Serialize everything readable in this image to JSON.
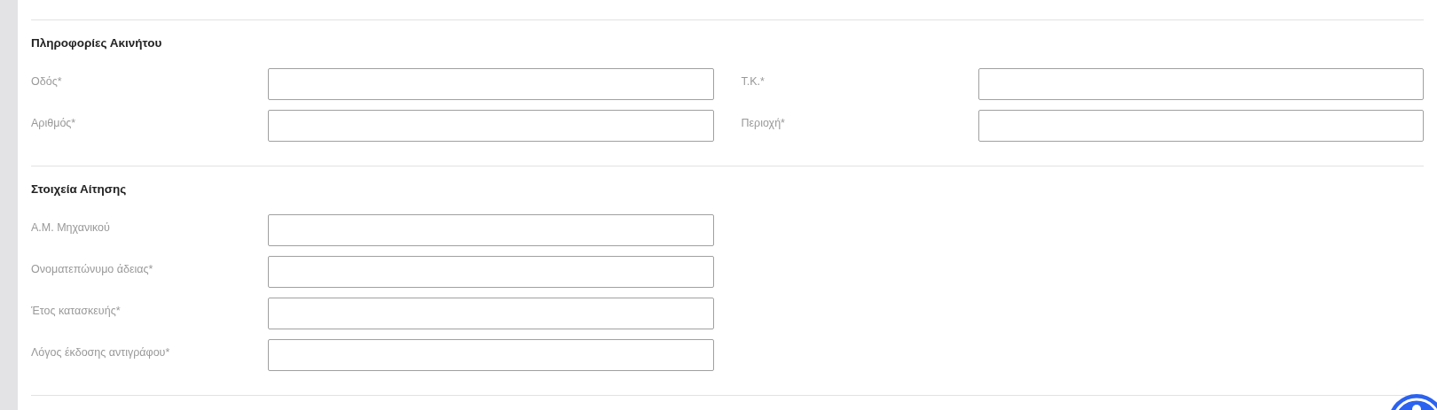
{
  "sections": [
    {
      "title": "Πληροφορίες Ακινήτου",
      "rows": [
        [
          {
            "label": "Οδός*"
          },
          {
            "label": "Τ.Κ.*"
          }
        ],
        [
          {
            "label": "Αριθμός*"
          },
          {
            "label": "Περιοχή*"
          }
        ]
      ]
    },
    {
      "title": "Στοιχεία Αίτησης",
      "rows": [
        [
          {
            "label": "Α.Μ. Μηχανικού"
          }
        ],
        [
          {
            "label": "Ονοματεπώνυμο άδειας*"
          }
        ],
        [
          {
            "label": "Έτος κατασκευής*"
          }
        ],
        [
          {
            "label": "Λόγος έκδοσης αντιγράφου*"
          }
        ]
      ]
    }
  ]
}
